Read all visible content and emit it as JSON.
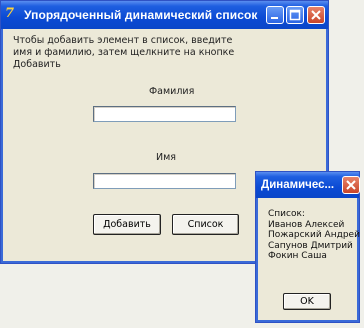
{
  "main_window": {
    "title": "Упорядоченный динамический список",
    "instruction": "Чтобы добавить элемент в список, введите имя и фамилию, затем щелкните на кнопке Добавить",
    "surname_label": "Фамилия",
    "name_label": "Имя",
    "surname_value": "",
    "name_value": "",
    "add_button": "Добавить",
    "list_button": "Список"
  },
  "dialog": {
    "title": "Динамичес...",
    "list_header": "Список:",
    "items": [
      "Иванов Алексей",
      "Пожарский Андрей",
      "Сапунов Дмитрий",
      "Фокин Саша"
    ],
    "ok_button": "OK"
  }
}
